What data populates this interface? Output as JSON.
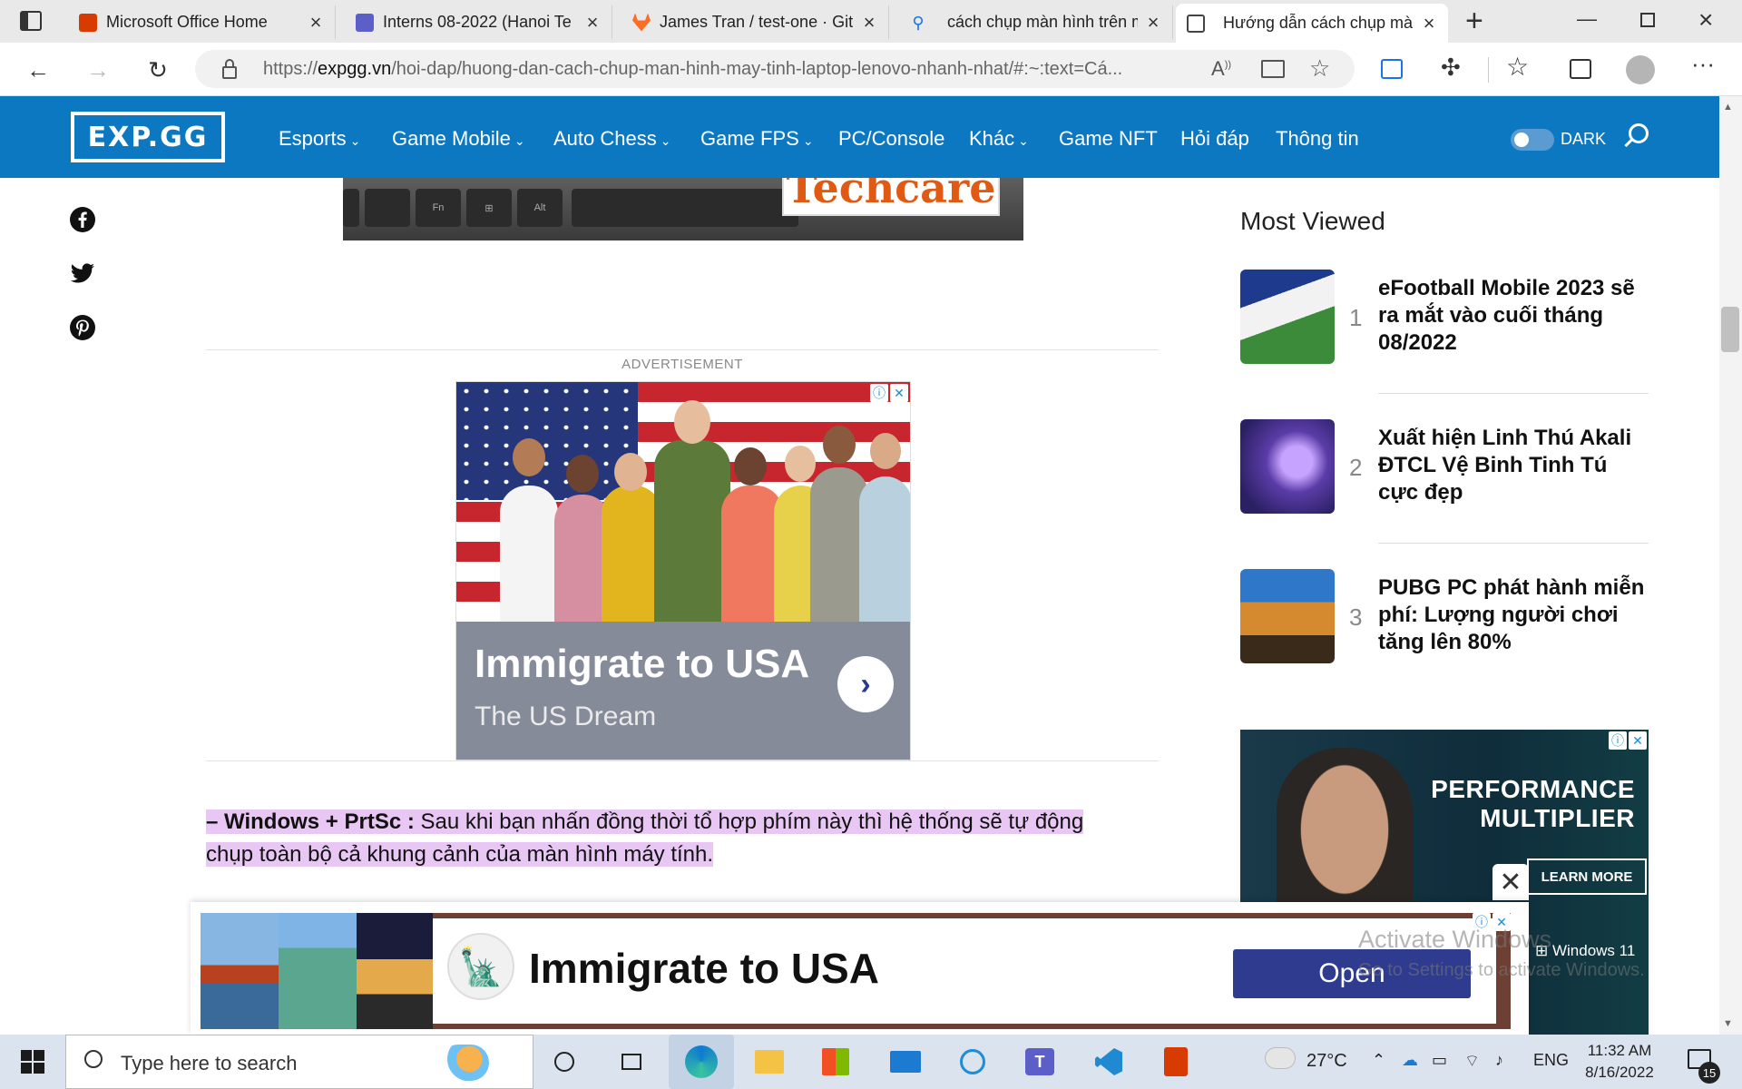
{
  "tabs": [
    {
      "title": "Microsoft Office Home",
      "icon": "office-icon",
      "color": "#d83b01"
    },
    {
      "title": "Interns 08-2022 (Hanoi Te",
      "icon": "teams-icon",
      "color": "#5b5fc7"
    },
    {
      "title": "James Tran / test-one · Git",
      "icon": "gitlab-icon",
      "color": "#fc6d26"
    },
    {
      "title": "cách chụp màn hình trên m",
      "icon": "search-icon",
      "color": "#1a73e8"
    },
    {
      "title": "Hướng dẫn cách chụp mà",
      "icon": "expgg-icon",
      "color": "#444444"
    }
  ],
  "url": {
    "prefix": "https://",
    "domain": "expgg.vn",
    "path": "/hoi-dap/huong-dan-cach-chup-man-hinh-may-tinh-laptop-lenovo-nhanh-nhat/#:~:text=Cá..."
  },
  "site": {
    "logo": "EXP.GG",
    "menu": [
      "Esports",
      "Game Mobile",
      "Auto Chess",
      "Game FPS",
      "PC/Console",
      "Khác",
      "Game NFT",
      "Hỏi đáp",
      "Thông tin"
    ],
    "dark_label": "DARK"
  },
  "content": {
    "keyboard_logo": "Techcare",
    "ad_label": "ADVERTISEMENT",
    "ad1": {
      "title": "Immigrate to USA",
      "subtitle": "The US Dream"
    },
    "paragraph": {
      "bold": "– Windows + PrtSc :",
      "text": " Sau khi bạn nhấn đồng thời tổ hợp phím này thì hệ thống sẽ tự động chụp toàn bộ cả khung cảnh của màn hình máy tính."
    }
  },
  "sidebar": {
    "title": "Most Viewed",
    "items": [
      {
        "rank": "1",
        "title": "eFootball Mobile 2023 sẽ ra mắt vào cuối tháng 08/2022"
      },
      {
        "rank": "2",
        "title": "Xuất hiện Linh Thú Akali ĐTCL Vệ Binh Tinh Tú cực đẹp"
      },
      {
        "rank": "3",
        "title": "PUBG PC phát hành miễn phí: Lượng người chơi tăng lên 80%"
      }
    ],
    "ad2": {
      "title": "PERFORMANCE MULTIPLIER",
      "cta": "LEARN MORE",
      "footer": "Windows 11"
    }
  },
  "sticky_ad": {
    "title": "Immigrate to USA",
    "button": "Open"
  },
  "watermark": {
    "line1": "Activate Windows",
    "line2": "Go to Settings to activate Windows."
  },
  "taskbar": {
    "search_placeholder": "Type here to search",
    "weather": "27°C",
    "language": "ENG",
    "time": "11:32 AM",
    "date": "8/16/2022",
    "notifications": "15"
  }
}
